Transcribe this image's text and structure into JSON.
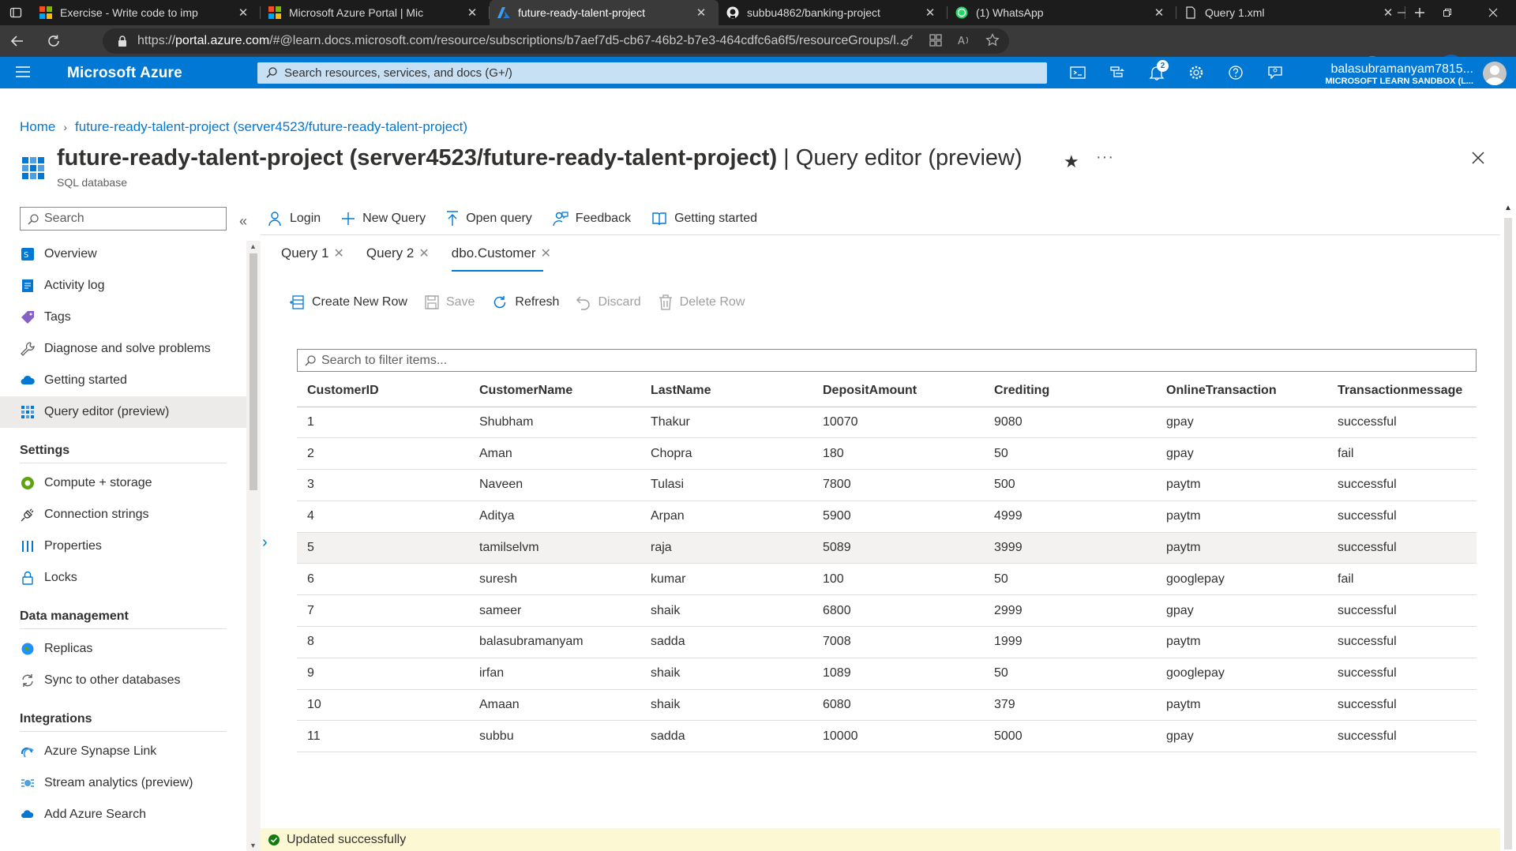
{
  "browser": {
    "tabs": [
      {
        "title": "Exercise - Write code to imp",
        "icon": "ms-learn-icon",
        "active": false
      },
      {
        "title": "Microsoft Azure Portal | Mic",
        "icon": "ms-learn-icon",
        "active": false
      },
      {
        "title": "future-ready-talent-project",
        "icon": "azure-icon",
        "active": true
      },
      {
        "title": "subbu4862/banking-project",
        "icon": "github-icon",
        "active": false
      },
      {
        "title": "(1) WhatsApp",
        "icon": "whatsapp-icon",
        "active": false
      },
      {
        "title": "Query 1.xml",
        "icon": "file-icon",
        "active": false
      }
    ],
    "url_prefix": "https://",
    "url_host": "portal.azure.com",
    "url_rest": "/#@learn.docs.microsoft.com/resource/subscriptions/b7aef7d5-cb67-46b2-b7e3-464cdfc6a6f5/resourceGroups/l..."
  },
  "azure": {
    "brand": "Microsoft Azure",
    "search_placeholder": "Search resources, services, and docs (G+/)",
    "notifications_count": "2",
    "account_user": "balasubramanyam7815...",
    "account_dir": "MICROSOFT LEARN SANDBOX (L..."
  },
  "breadcrumb": {
    "home": "Home",
    "current": "future-ready-talent-project (server4523/future-ready-talent-project)"
  },
  "page": {
    "title_main": "future-ready-talent-project (server4523/future-ready-talent-project)",
    "title_suffix": " | Query editor (preview)",
    "subtitle": "SQL database"
  },
  "sidebar": {
    "search_placeholder": "Search",
    "items": [
      {
        "label": "Overview",
        "icon": "sql-icon"
      },
      {
        "label": "Activity log",
        "icon": "activity-log-icon"
      },
      {
        "label": "Tags",
        "icon": "tag-icon"
      },
      {
        "label": "Diagnose and solve problems",
        "icon": "wrench-icon"
      },
      {
        "label": "Getting started",
        "icon": "cloud-icon"
      },
      {
        "label": "Query editor (preview)",
        "icon": "query-editor-icon",
        "selected": true
      }
    ],
    "section_settings": "Settings",
    "settings_items": [
      {
        "label": "Compute + storage",
        "icon": "compute-icon"
      },
      {
        "label": "Connection strings",
        "icon": "plug-icon"
      },
      {
        "label": "Properties",
        "icon": "properties-icon"
      },
      {
        "label": "Locks",
        "icon": "lock-icon"
      }
    ],
    "section_data": "Data management",
    "data_items": [
      {
        "label": "Replicas",
        "icon": "globe-icon"
      },
      {
        "label": "Sync to other databases",
        "icon": "sync-icon"
      }
    ],
    "section_integrations": "Integrations",
    "integration_items": [
      {
        "label": "Azure Synapse Link",
        "icon": "synapse-icon"
      },
      {
        "label": "Stream analytics (preview)",
        "icon": "stream-icon"
      },
      {
        "label": "Add Azure Search",
        "icon": "search-cloud-icon"
      }
    ]
  },
  "toolbar": {
    "login": "Login",
    "new_query": "New Query",
    "open_query": "Open query",
    "feedback": "Feedback",
    "getting_started": "Getting started"
  },
  "query_tabs": [
    "Query 1",
    "Query 2",
    "dbo.Customer"
  ],
  "row_toolbar": {
    "create": "Create New Row",
    "save": "Save",
    "refresh": "Refresh",
    "discard": "Discard",
    "delete": "Delete Row"
  },
  "filter_placeholder": "Search to filter items...",
  "table": {
    "columns": [
      "CustomerID",
      "CustomerName",
      "LastName",
      "DepositAmount",
      "Crediting",
      "OnlineTransaction",
      "Transactionmessage"
    ],
    "rows": [
      [
        "1",
        "Shubham",
        "Thakur",
        "10070",
        "9080",
        "gpay",
        "successful"
      ],
      [
        "2",
        "Aman",
        "Chopra",
        "180",
        "50",
        "gpay",
        "fail"
      ],
      [
        "3",
        "Naveen",
        "Tulasi",
        "7800",
        "500",
        "paytm",
        "successful"
      ],
      [
        "4",
        "Aditya",
        "Arpan",
        "5900",
        "4999",
        "paytm",
        "successful"
      ],
      [
        "5",
        "tamilselvm",
        "raja",
        "5089",
        "3999",
        "paytm",
        "successful"
      ],
      [
        "6",
        "suresh",
        "kumar",
        "100",
        "50",
        "googlepay",
        "fail"
      ],
      [
        "7",
        "sameer",
        "shaik",
        "6800",
        "2999",
        "gpay",
        "successful"
      ],
      [
        "8",
        "balasubramanyam",
        "sadda",
        "7008",
        "1999",
        "paytm",
        "successful"
      ],
      [
        "9",
        "irfan",
        "shaik",
        "1089",
        "50",
        "googlepay",
        "successful"
      ],
      [
        "10",
        "Amaan",
        "shaik",
        "6080",
        "379",
        "paytm",
        "successful"
      ],
      [
        "11",
        "subbu",
        "sadda",
        "10000",
        "5000",
        "gpay",
        "successful"
      ]
    ],
    "highlighted_row": 4
  },
  "status_message": "Updated successfully",
  "colors": {
    "azure_blue": "#0078d4",
    "status_bg": "#fcf8d3",
    "success_green": "#107c10"
  }
}
